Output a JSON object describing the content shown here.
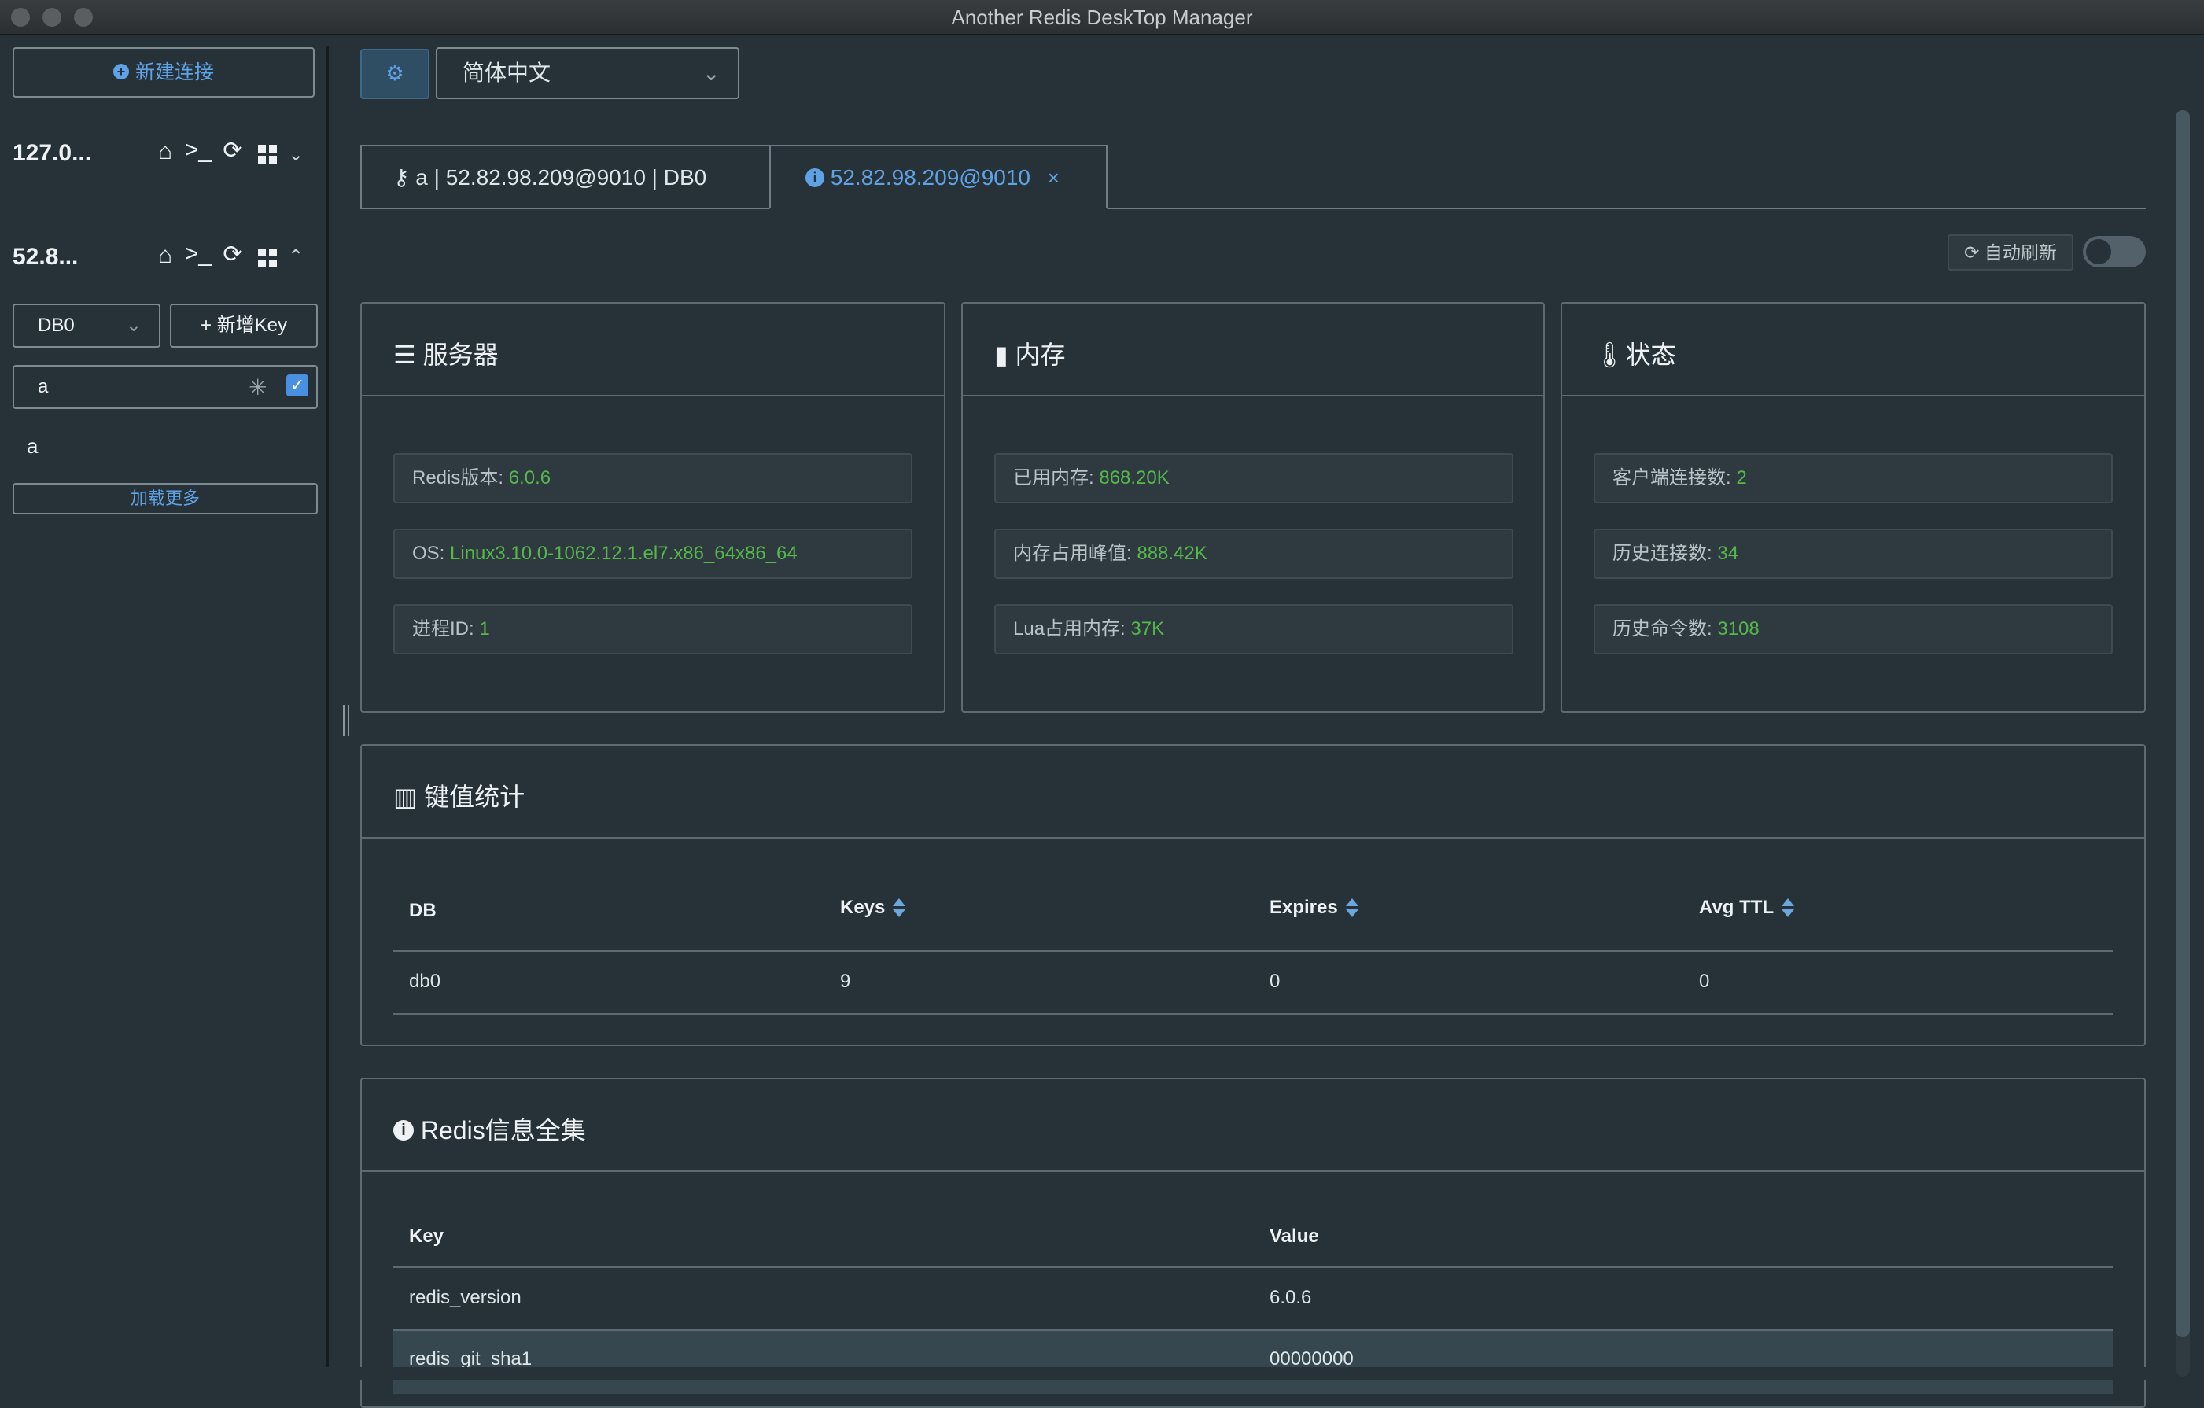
{
  "window": {
    "title": "Another Redis DeskTop Manager"
  },
  "sidebar": {
    "new_connection_label": "新建连接",
    "connections": [
      {
        "name": "127.0...",
        "expanded": false
      },
      {
        "name": "52.8...",
        "expanded": true
      }
    ],
    "db_select": "DB0",
    "add_key_label": "新增Key",
    "search_value": "a",
    "keys": [
      "a"
    ],
    "load_more_label": "加载更多"
  },
  "toolbar": {
    "language": "简体中文"
  },
  "tabs": [
    {
      "label": "a | 52.82.98.209@9010 | DB0",
      "icon": "key-icon",
      "active": false
    },
    {
      "label": "52.82.98.209@9010",
      "icon": "info-icon",
      "active": true,
      "close": "×"
    }
  ],
  "auto_refresh": {
    "label": "自动刷新",
    "enabled": false
  },
  "server_card": {
    "title": "服务器",
    "rows": [
      {
        "label": "Redis版本: ",
        "value": "6.0.6"
      },
      {
        "label": "OS: ",
        "value": "Linux3.10.0-1062.12.1.el7.x86_64x86_64"
      },
      {
        "label": "进程ID: ",
        "value": "1"
      }
    ]
  },
  "memory_card": {
    "title": "内存",
    "rows": [
      {
        "label": "已用内存: ",
        "value": "868.20K"
      },
      {
        "label": "内存占用峰值: ",
        "value": "888.42K"
      },
      {
        "label": "Lua占用内存: ",
        "value": "37K"
      }
    ]
  },
  "status_card": {
    "title": "状态",
    "rows": [
      {
        "label": "客户端连接数: ",
        "value": "2"
      },
      {
        "label": "历史连接数: ",
        "value": "34"
      },
      {
        "label": "历史命令数: ",
        "value": "3108"
      }
    ]
  },
  "keystats": {
    "title": "键值统计",
    "headers": [
      "DB",
      "Keys",
      "Expires",
      "Avg TTL"
    ],
    "rows": [
      [
        "db0",
        "9",
        "0",
        "0"
      ]
    ]
  },
  "redis_info": {
    "title": "Redis信息全集",
    "headers": [
      "Key",
      "Value"
    ],
    "rows": [
      [
        "redis_version",
        "6.0.6"
      ],
      [
        "redis_git_sha1",
        "00000000"
      ]
    ]
  },
  "colors": {
    "background": "#263238",
    "accent": "#5fa3e6",
    "value_green": "#54b84a"
  }
}
